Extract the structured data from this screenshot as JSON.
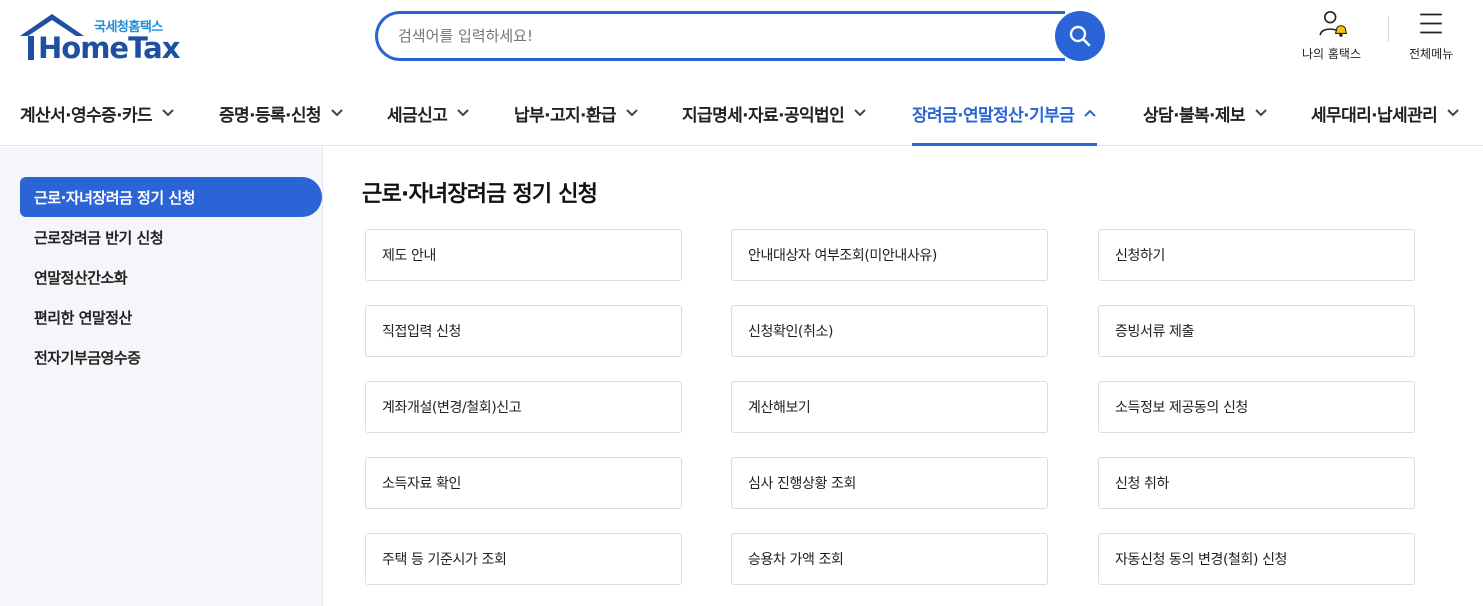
{
  "header": {
    "logo_sub": "국세청홈택스",
    "logo_main": "HomeTax",
    "search_placeholder": "검색어를 입력하세요!",
    "my_hometax": "나의 홈택스",
    "all_menu": "전체메뉴"
  },
  "gnb": [
    {
      "label": "계산서·영수증·카드"
    },
    {
      "label": "증명·등록·신청"
    },
    {
      "label": "세금신고"
    },
    {
      "label": "납부·고지·환급"
    },
    {
      "label": "지급명세·자료·공익법인"
    },
    {
      "label": "장려금·연말정산·기부금"
    },
    {
      "label": "상담·불복·제보"
    },
    {
      "label": "세무대리·납세관리"
    }
  ],
  "sidebar": [
    {
      "label": "근로·자녀장려금 정기 신청"
    },
    {
      "label": "근로장려금 반기 신청"
    },
    {
      "label": "연말정산간소화"
    },
    {
      "label": "편리한 연말정산"
    },
    {
      "label": "전자기부금영수증"
    }
  ],
  "main": {
    "title": "근로·자녀장려금 정기 신청",
    "cards": [
      "제도 안내",
      "안내대상자 여부조회(미안내사유)",
      "신청하기",
      "직접입력 신청",
      "신청확인(취소)",
      "증빙서류 제출",
      "계좌개설(변경/철회)신고",
      "계산해보기",
      "소득정보 제공동의 신청",
      "소득자료 확인",
      "심사 진행상황 조회",
      "신청 취하",
      "주택 등 기준시가 조회",
      "승용차 가액 조회",
      "자동신청 동의 변경(철회) 신청"
    ]
  },
  "colors": {
    "accent": "#2a64d6",
    "logo_blue": "#1e4fa1",
    "logo_sub": "#1a8fd8",
    "bell": "#f5c400"
  }
}
